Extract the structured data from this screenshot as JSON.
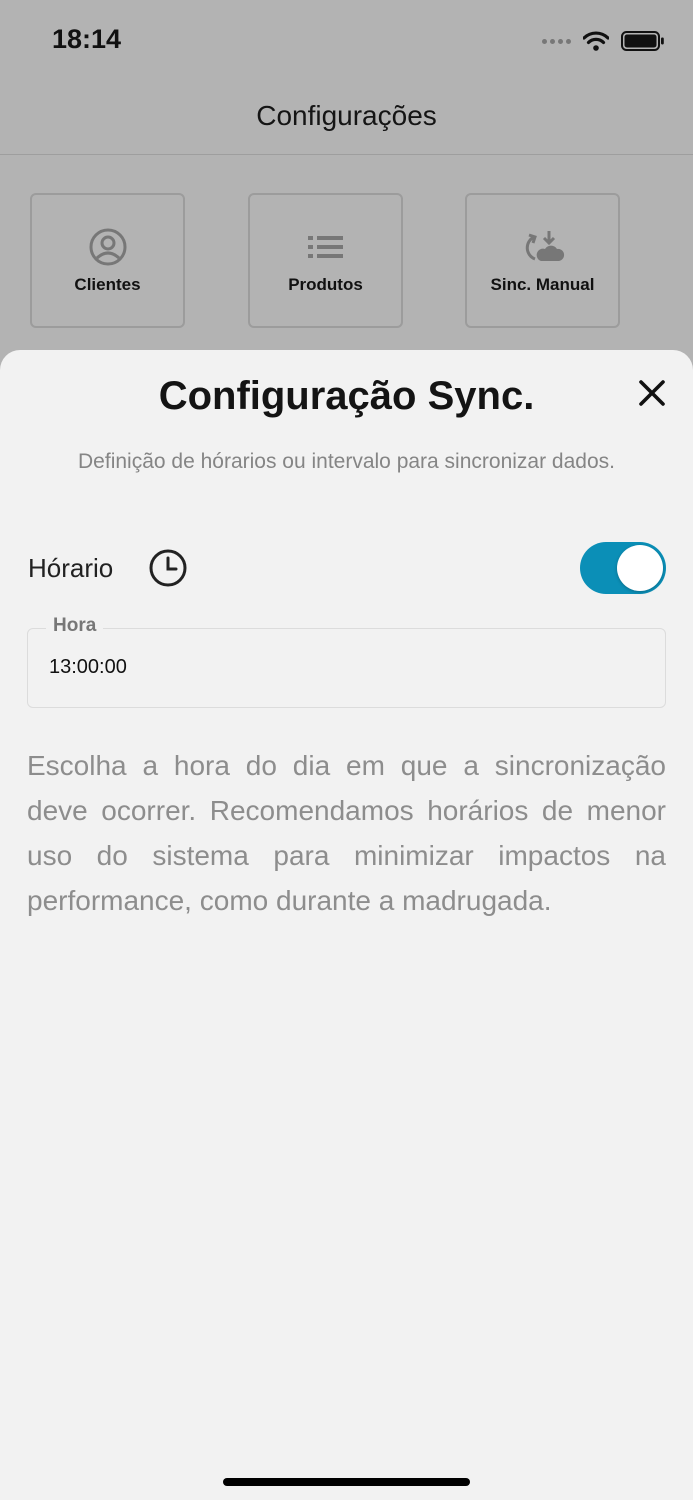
{
  "status_bar": {
    "time": "18:14"
  },
  "header": {
    "title": "Configurações"
  },
  "tiles": [
    {
      "label": "Clientes",
      "icon": "user-circle-icon"
    },
    {
      "label": "Produtos",
      "icon": "list-icon"
    },
    {
      "label": "Sinc. Manual",
      "icon": "cloud-sync-icon"
    }
  ],
  "sheet": {
    "title": "Configuração Sync.",
    "subtitle": "Definição de hórarios ou intervalo para sincronizar dados.",
    "schedule_label": "Hórario",
    "toggle_on": true,
    "field": {
      "label": "Hora",
      "value": "13:00:00"
    },
    "help_text": "Escolha a hora do dia em que a sincronização deve ocorrer. Recomendamos horários de menor uso do sistema para minimizar impactos na performance, como durante a madrugada."
  },
  "colors": {
    "accent": "#0b8fb7",
    "sheet_bg": "#f2f2f2",
    "overlay_bg": "#b3b3b3"
  }
}
